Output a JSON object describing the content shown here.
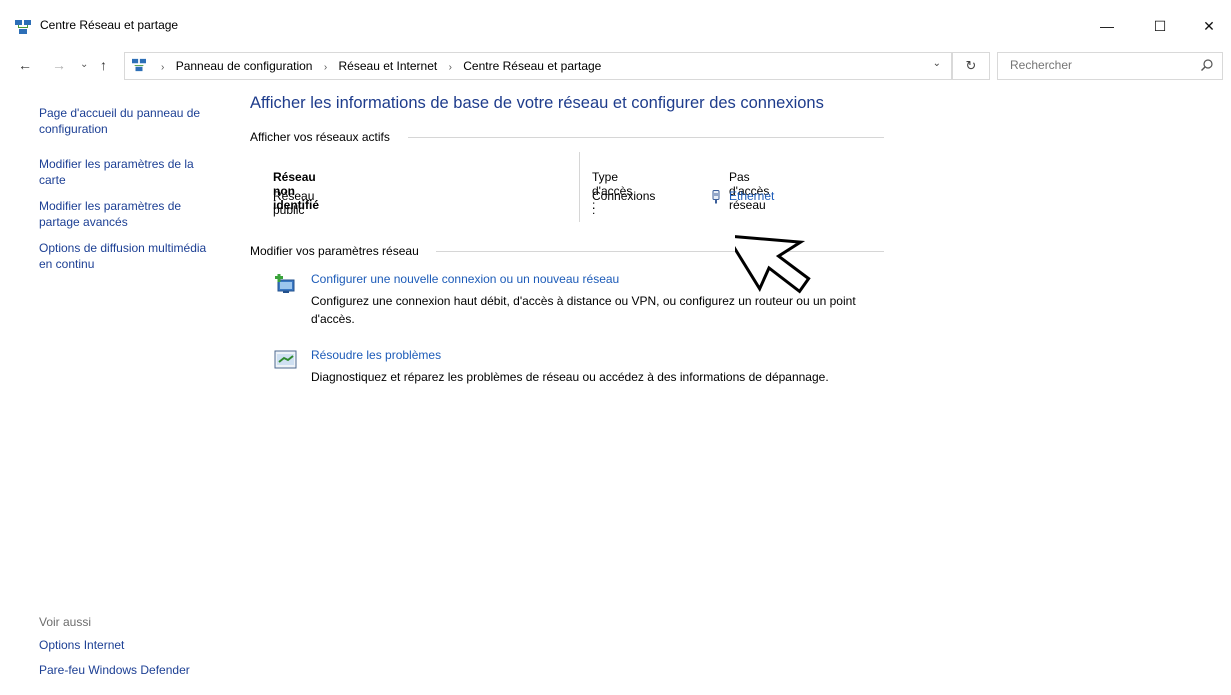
{
  "window": {
    "title": "Centre Réseau et partage",
    "controls": {
      "minimize": "—",
      "maximize": "☐",
      "close": "✕"
    }
  },
  "address_bar": {
    "crumbs": [
      "Panneau de configuration",
      "Réseau et Internet",
      "Centre Réseau et partage"
    ],
    "search_placeholder": "Rechercher"
  },
  "sidebar": {
    "links": [
      "Page d'accueil du panneau de configuration",
      "Modifier les paramètres de la carte",
      "Modifier les paramètres de partage avancés",
      "Options de diffusion multimédia en continu"
    ],
    "see_also_label": "Voir aussi",
    "see_also_links": [
      "Options Internet",
      "Pare-feu Windows Defender"
    ]
  },
  "main": {
    "heading": "Afficher les informations de base de votre réseau et configurer des connexions",
    "active_networks_title": "Afficher vos réseaux actifs",
    "network": {
      "name": "Réseau non identifié",
      "category": "Réseau public",
      "access_type_label": "Type d'accès :",
      "access_type_value": "Pas d'accès réseau",
      "connections_label": "Connexions :",
      "connection_name": "Ethernet"
    },
    "change_settings_title": "Modifier vos paramètres réseau",
    "tasks": [
      {
        "title": "Configurer une nouvelle connexion ou un nouveau réseau",
        "description": "Configurez une connexion haut débit, d'accès à distance ou VPN, ou configurez un routeur ou un point d'accès.",
        "icon": "new-connection-icon"
      },
      {
        "title": "Résoudre les problèmes",
        "description": "Diagnostiquez et réparez les problèmes de réseau ou accédez à des informations de dépannage.",
        "icon": "troubleshoot-icon"
      }
    ]
  },
  "colors": {
    "link": "#1c5bb8",
    "heading": "#1e3c8c",
    "sidebar_link": "#1c3f94"
  }
}
